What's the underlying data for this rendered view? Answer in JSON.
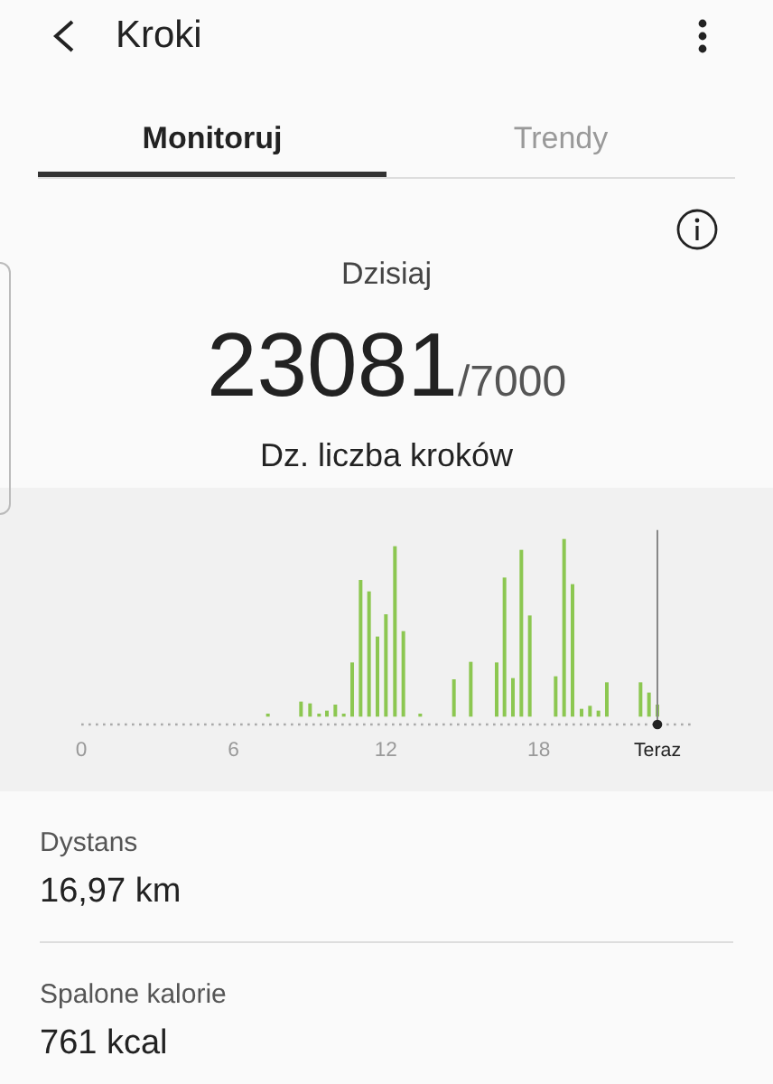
{
  "header": {
    "title": "Kroki"
  },
  "tabs": [
    {
      "label": "Monitoruj",
      "selected": true
    },
    {
      "label": "Trendy",
      "selected": false
    }
  ],
  "summary": {
    "day": "Dzisiaj",
    "steps": "23081",
    "goal": "/7000",
    "goal_label": "Dz. liczba kroków"
  },
  "chart": {
    "x_labels": [
      "0",
      "6",
      "12",
      "18"
    ],
    "now_label": "Teraz"
  },
  "stats": [
    {
      "label": "Dystans",
      "value": "16,97 km"
    },
    {
      "label": "Spalone kalorie",
      "value": "761 kcal"
    }
  ]
}
